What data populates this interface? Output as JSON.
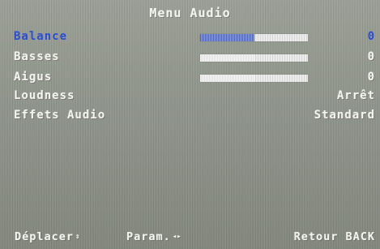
{
  "menu": {
    "title": "Menu Audio",
    "items": [
      {
        "label": "Balance",
        "value": "0",
        "level": 0.5,
        "has_bar": true,
        "selected": true
      },
      {
        "label": "Basses",
        "value": "0",
        "level": 0.5,
        "has_bar": true,
        "selected": false
      },
      {
        "label": "Aigus",
        "value": "0",
        "level": 0.5,
        "has_bar": true,
        "selected": false
      },
      {
        "label": "Loudness",
        "value": "Arrêt",
        "has_bar": false,
        "selected": false
      },
      {
        "label": "Effets Audio",
        "value": "Standard",
        "has_bar": false,
        "selected": false
      }
    ]
  },
  "footer": {
    "move_label": "Déplacer",
    "move_icon": "⇕",
    "param_label": "Param.",
    "param_icon": "◂▸",
    "back_label": "Retour BACK"
  },
  "colors": {
    "selected": "#2f4fc6",
    "text": "#f3f3ee",
    "background": "#979b92"
  }
}
